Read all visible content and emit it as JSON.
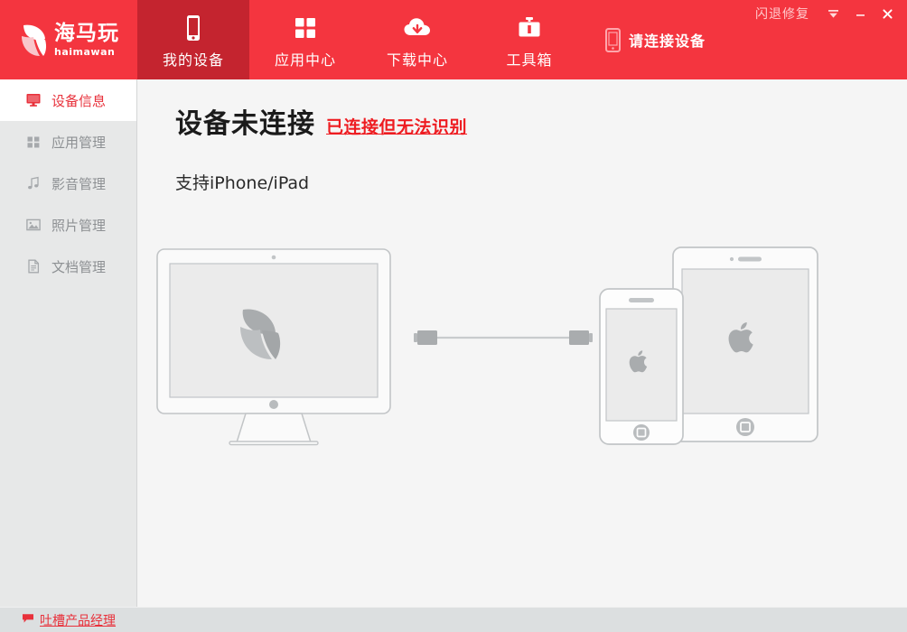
{
  "app": {
    "logo_cn": "海马玩",
    "logo_en": "haimawan",
    "logo_icon": "shell-logo-icon"
  },
  "titlebar": {
    "repair_label": "闪退修复",
    "collapse_icon": "collapse-arrow-icon",
    "minimize_icon": "minimize-icon",
    "close_icon": "close-icon"
  },
  "nav": {
    "items": [
      {
        "label": "我的设备",
        "icon": "phone-icon",
        "active": true
      },
      {
        "label": "应用中心",
        "icon": "grid-apps-icon",
        "active": false
      },
      {
        "label": "下载中心",
        "icon": "cloud-download-icon",
        "active": false
      },
      {
        "label": "工具箱",
        "icon": "toolbox-icon",
        "active": false
      }
    ],
    "connect_status": {
      "label": "请连接设备",
      "icon": "phone-outline-icon"
    }
  },
  "sidebar": {
    "items": [
      {
        "label": "设备信息",
        "icon": "monitor-icon",
        "active": true
      },
      {
        "label": "应用管理",
        "icon": "grid-apps-icon",
        "active": false
      },
      {
        "label": "影音管理",
        "icon": "music-note-icon",
        "active": false
      },
      {
        "label": "照片管理",
        "icon": "photo-icon",
        "active": false
      },
      {
        "label": "文档管理",
        "icon": "document-icon",
        "active": false
      }
    ]
  },
  "main": {
    "title": "设备未连接",
    "title_link": "已连接但无法识别",
    "subtitle": "支持iPhone/iPad",
    "illustration": {
      "monitor_icon": "desktop-monitor-illustration",
      "cable_icon": "usb-cable-illustration",
      "iphone_icon": "iphone-illustration",
      "ipad_icon": "ipad-illustration"
    }
  },
  "footer": {
    "feedback_label": "吐槽产品经理",
    "feedback_icon": "speech-bubble-icon"
  },
  "colors": {
    "header_red": "#f4353f",
    "active_tab_red": "#c4242f",
    "accent_red": "#e8323c",
    "link_red": "#ee1c21",
    "sidebar_bg": "#e7e8e8",
    "content_bg": "#f5f5f5",
    "footer_bg": "#dcdfe0"
  }
}
